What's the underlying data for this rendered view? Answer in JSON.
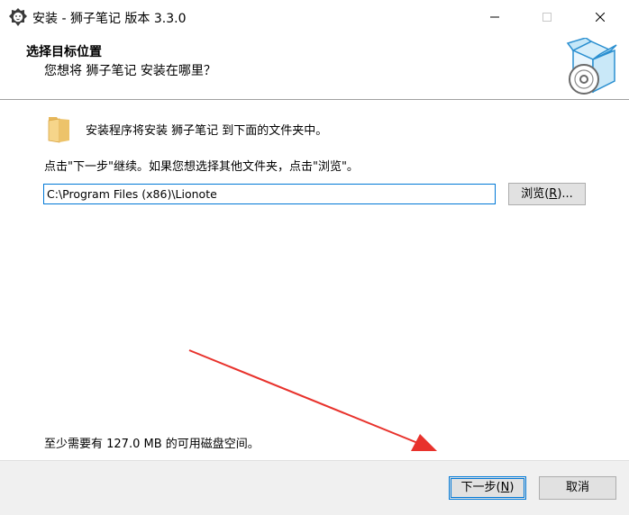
{
  "window": {
    "title": "安装 - 狮子笔记 版本 3.3.0",
    "controls": {
      "minimize_icon": "minimize-icon",
      "maximize_icon": "maximize-icon",
      "close_icon": "close-icon"
    }
  },
  "header": {
    "title": "选择目标位置",
    "subtitle": "您想将 狮子笔记 安装在哪里？",
    "icon": "install-box-disc-icon"
  },
  "main": {
    "folder_icon": "folder-icon",
    "intro": "安装程序将安装 狮子笔记 到下面的文件夹中。",
    "instruction": "点击\"下一步\"继续。如果您想选择其他文件夹，点击\"浏览\"。",
    "path_value": "C:\\Program Files (x86)\\Lionote",
    "browse_label_prefix": "浏览(",
    "browse_label_key": "R",
    "browse_label_suffix": ")...",
    "space_required": "至少需要有 127.0 MB 的可用磁盘空间。"
  },
  "footer": {
    "next_prefix": "下一步(",
    "next_key": "N",
    "next_suffix": ")",
    "cancel_label": "取消"
  },
  "annotation": {
    "color": "#e8322c"
  },
  "colors": {
    "accent": "#0078d7",
    "footer_bg": "#f0f0f0",
    "button_bg": "#e1e1e1"
  }
}
